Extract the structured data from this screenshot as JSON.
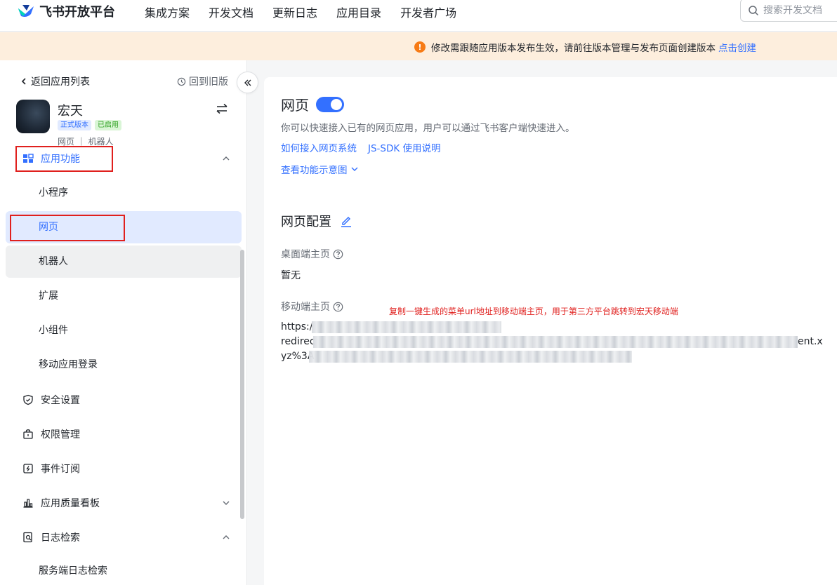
{
  "header": {
    "brand": "飞书开放平台",
    "nav": [
      "集成方案",
      "开发文档",
      "更新日志",
      "应用目录",
      "开发者广场"
    ],
    "search_placeholder": "搜索开发文档"
  },
  "banner": {
    "text": "修改需跟随应用版本发布生效，请前往版本管理与发布页面创建版本",
    "link": "点击创建",
    "icon": "warning-icon",
    "color": "#f77b15"
  },
  "sidebar": {
    "back_label": "返回应用列表",
    "old_version_label": "回到旧版",
    "app": {
      "name": "宏天",
      "badges": [
        "正式版本",
        "已启用"
      ],
      "tags": "网页 ｜ 机器人"
    },
    "group_label": "应用功能",
    "sub_items": [
      "小程序",
      "网页",
      "机器人",
      "扩展",
      "小组件",
      "移动应用登录"
    ],
    "active_item": "网页",
    "items": [
      {
        "label": "安全设置",
        "icon": "shield-icon"
      },
      {
        "label": "权限管理",
        "icon": "lock-icon"
      },
      {
        "label": "事件订阅",
        "icon": "event-icon"
      },
      {
        "label": "应用质量看板",
        "icon": "chart-icon"
      },
      {
        "label": "日志检索",
        "icon": "log-search-icon"
      }
    ],
    "log_sub_item": "服务端日志检索"
  },
  "main": {
    "title": "网页",
    "toggle_on": true,
    "description": "你可以快速接入已有的网页应用，用户可以通过飞书客户端快速进入。",
    "links": [
      "如何接入网页系统",
      "JS-SDK 使用说明"
    ],
    "view_demo": "查看功能示意图",
    "config_title": "网页配置",
    "desktop_label": "桌面端主页",
    "desktop_value": "暂无",
    "mobile_label": "移动端主页",
    "annotation": "复制一键生成的菜单url地址到移动端主页，用于第三方平台跳转到宏天移动端",
    "url_lines": [
      "https:/",
      "redirec",
      "ent.x",
      "yz%3A"
    ],
    "accent": "#3370ff"
  }
}
